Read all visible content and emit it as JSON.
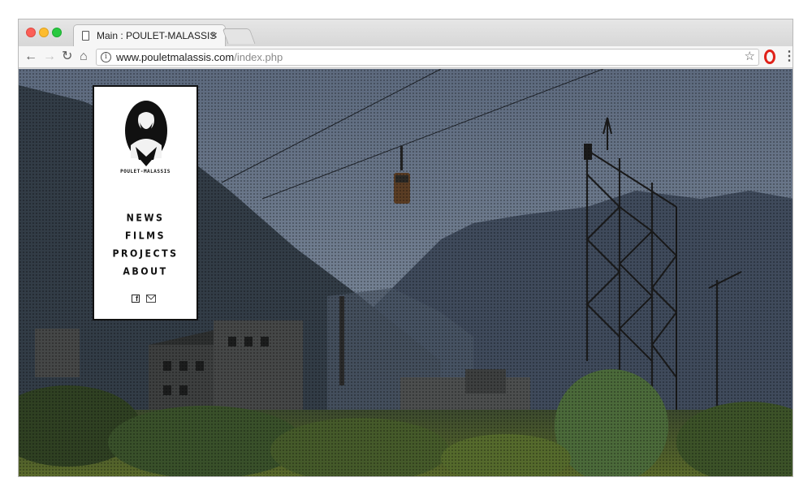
{
  "browser": {
    "tab_title": "Main : POULET-MALASSIS",
    "tab_close": "×",
    "url_host": "www.pouletmalassis.com",
    "url_path": "/index.php",
    "info_glyph": "i",
    "icons": [
      "back-icon",
      "forward-icon",
      "reload-icon",
      "home-icon",
      "info-icon",
      "star-icon",
      "opera-icon",
      "menu-icon"
    ]
  },
  "site": {
    "brand": "POULET-MALASSIS",
    "nav": [
      "NEWS",
      "FILMS",
      "PROJECTS",
      "ABOUT"
    ],
    "social": {
      "facebook": "f"
    },
    "background": "abandoned industrial site with cable car and steel pylon in mountain valley"
  },
  "colors": {
    "close_red": "#fc5f57",
    "minimize_yellow": "#fdbc2e",
    "zoom_green": "#28c940",
    "opera_red": "#e0221a"
  }
}
